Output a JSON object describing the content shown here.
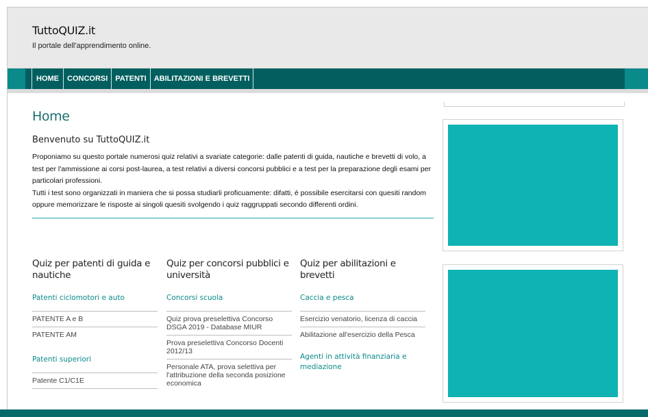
{
  "header": {
    "site_title": "TuttoQUIZ.it",
    "tagline": "Il portale dell'apprendimento online."
  },
  "nav": {
    "items": [
      {
        "label": "HOME"
      },
      {
        "label": "CONCORSI"
      },
      {
        "label": "PATENTI"
      },
      {
        "label": "ABILITAZIONI E BREVETTI"
      }
    ]
  },
  "main": {
    "page_title": "Home",
    "welcome_title": "Benvenuto su TuttoQUIZ.it",
    "paragraph_1": "Proponiamo su questo portale numerosi quiz relativi a svariate categorie: dalle patenti di guida, nautiche e brevetti di volo, a test per l'ammissione ai corsi post-laurea, a test relativi a diversi concorsi pubblici e a test per la preparazione degli esami per particolari professioni.",
    "paragraph_2": "Tutti i test sono organizzati in maniera che si possa studiarli proficuamente: difatti, è possibile esercitarsi con quesiti random oppure memorizzare le risposte ai singoli quesiti svolgendo i quiz raggruppati secondo differenti ordini."
  },
  "columns": [
    {
      "heading": "Quiz per patenti di guida e nautiche",
      "sections": [
        {
          "title": "Patenti ciclomotori e auto",
          "items": [
            "PATENTE A e B",
            "PATENTE AM"
          ]
        },
        {
          "title": "Patenti superiori",
          "items": [
            "Patente C1/C1E"
          ]
        }
      ]
    },
    {
      "heading": "Quiz per concorsi pubblici e università",
      "sections": [
        {
          "title": "Concorsi scuola",
          "items": [
            "Quiz prova preselettiva Concorso DSGA 2019 - Database MIUR",
            "Prova preselettiva Concorso Docenti 2012/13",
            "Personale ATA, prova selettiva per l'attribuzione della seconda posizione economica"
          ]
        }
      ]
    },
    {
      "heading": "Quiz per abilitazioni e brevetti",
      "sections": [
        {
          "title": "Caccia e pesca",
          "items": [
            "Esercizio venatorio, licenza di caccia",
            "Abilitazione all'esercizio della Pesca"
          ]
        },
        {
          "title": "Agenti in attività finanziaria e mediazione",
          "items": []
        }
      ]
    }
  ],
  "colors": {
    "nav_dark": "#035f5f",
    "nav_light": "#0a8a8a",
    "accent": "#0b8a8a",
    "ad_fill": "#0fb3b3"
  }
}
